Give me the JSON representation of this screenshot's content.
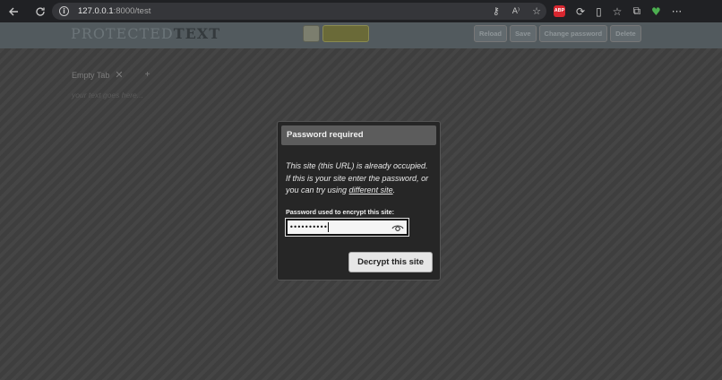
{
  "browser": {
    "url_host": "127.0.0.1",
    "url_port_path": ":8000/test",
    "nav_icons": [
      "back-arrow-icon",
      "refresh-icon",
      "info-icon"
    ],
    "ext_abp_label": "ABP"
  },
  "header": {
    "logo_light": "PROTECTED",
    "logo_bold": "TEXT",
    "buttons": {
      "reload": "Reload",
      "save": "Save",
      "change_password": "Change password",
      "delete": "Delete"
    }
  },
  "content": {
    "tab_label": "Empty Tab",
    "tab_close": "✕",
    "tab_add": "+",
    "placeholder": "your text goes here..."
  },
  "modal": {
    "title": "Password required",
    "message_part1": "This site (this URL) is already occupied. If this is your site enter the password, or you can try using ",
    "message_link": "different site",
    "message_end": ".",
    "password_label": "Password used to encrypt this site:",
    "password_masked": "••••••••••",
    "decrypt_button": "Decrypt this site"
  },
  "colors": {
    "browser_bg": "#202124",
    "header_bg": "#525a5e",
    "modal_bg": "#262626",
    "modal_title_bg": "#5c5c5c"
  }
}
